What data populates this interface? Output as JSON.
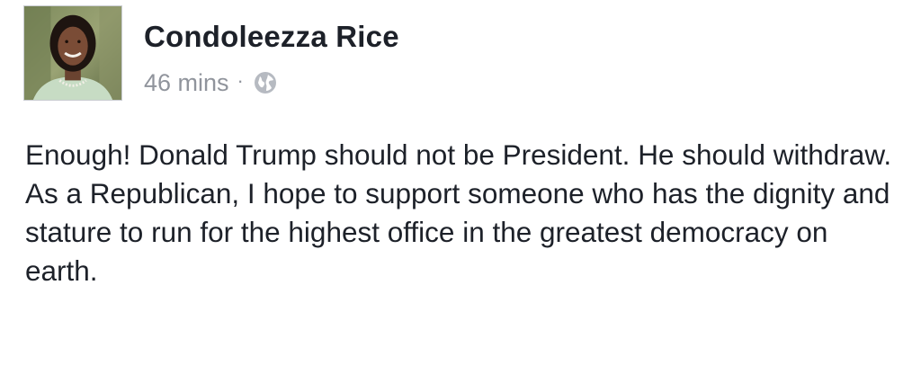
{
  "post": {
    "author": {
      "name": "Condoleezza Rice",
      "avatar_icon": "profile-photo"
    },
    "timestamp": "46 mins",
    "separator": "·",
    "privacy_icon": "globe-icon",
    "paragraphs": [
      "Enough! Donald Trump should not be President. He should withdraw.",
      "As a Republican, I hope to support someone who has the dignity and stature to run for the highest office in the greatest democracy on earth."
    ]
  },
  "colors": {
    "text": "#1d2129",
    "meta_text": "#90949c",
    "avatar_border": "#c9ccd1",
    "background": "#ffffff"
  }
}
